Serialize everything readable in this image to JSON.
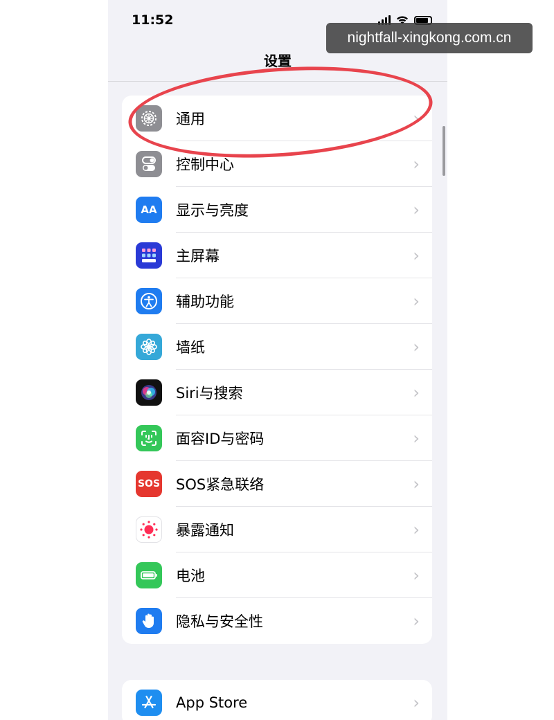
{
  "status_bar": {
    "time": "11:52"
  },
  "nav": {
    "title": "设置"
  },
  "settings_group_1": [
    {
      "label": "通用",
      "icon": "gear-icon",
      "color": "#8e8e93"
    },
    {
      "label": "控制中心",
      "icon": "toggle-icon",
      "color": "#8e8e93"
    },
    {
      "label": "显示与亮度",
      "icon": "text-size-icon",
      "icon_text": "AA",
      "color": "#1f7cf0"
    },
    {
      "label": "主屏幕",
      "icon": "home-grid-icon",
      "color": "#2a3ad6"
    },
    {
      "label": "辅助功能",
      "icon": "accessibility-icon",
      "color": "#1f7cf0"
    },
    {
      "label": "墙纸",
      "icon": "flower-icon",
      "color": "#35a8d8"
    },
    {
      "label": "Siri与搜索",
      "icon": "siri-icon",
      "color": "#111111"
    },
    {
      "label": "面容ID与密码",
      "icon": "face-id-icon",
      "color": "#34c759"
    },
    {
      "label": "SOS紧急联络",
      "icon": "sos-icon",
      "icon_text": "SOS",
      "color": "#e5372f"
    },
    {
      "label": "暴露通知",
      "icon": "exposure-icon",
      "color": "#ffffff"
    },
    {
      "label": "电池",
      "icon": "battery-icon",
      "color": "#34c759"
    },
    {
      "label": "隐私与安全性",
      "icon": "hand-icon",
      "color": "#1f7cf0"
    }
  ],
  "settings_group_2": [
    {
      "label": "App Store",
      "icon": "app-store-icon",
      "color": "#1f8ef0"
    }
  ],
  "watermark": "nightfall-xingkong.com.cn",
  "annotation_color": "#e8444d"
}
